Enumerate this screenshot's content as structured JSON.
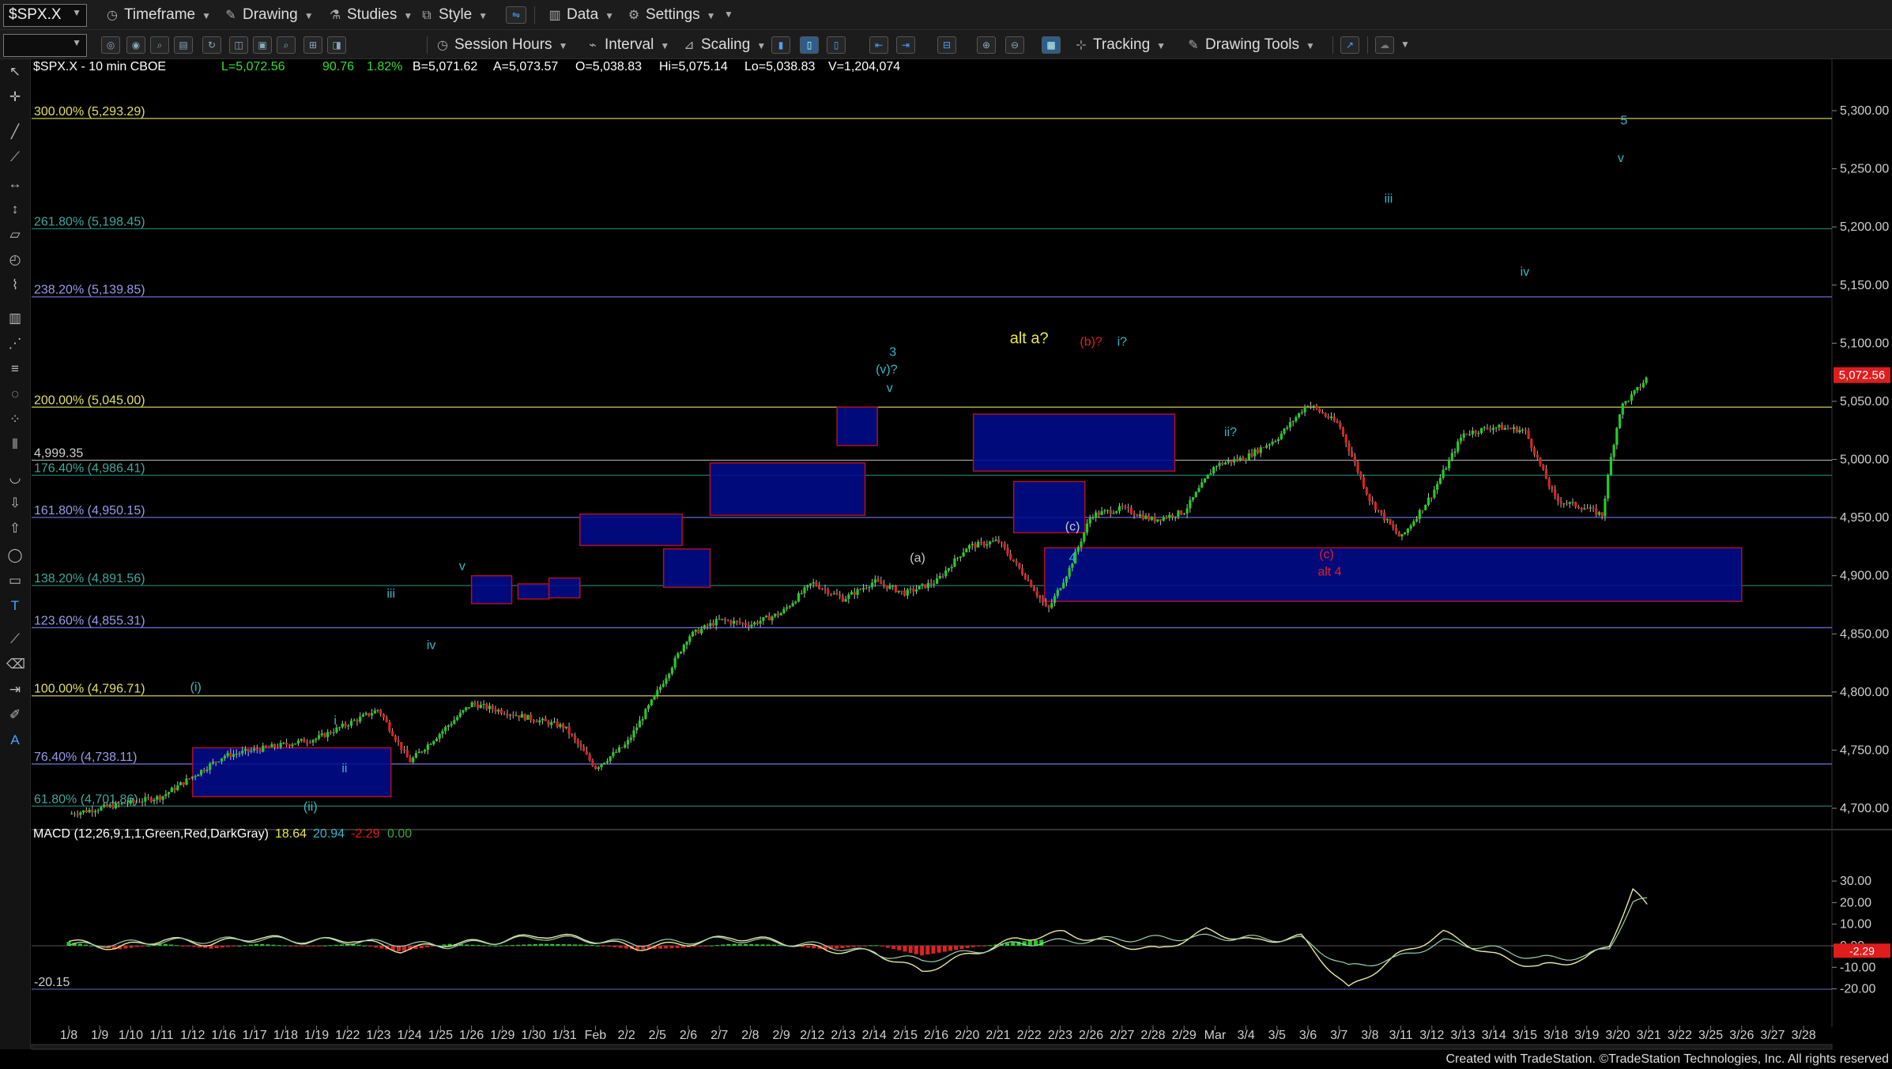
{
  "toolbar1": {
    "symbol": "$SPX.X",
    "items": [
      "Timeframe",
      "Drawing",
      "Studies",
      "Style",
      "Data",
      "Settings"
    ]
  },
  "toolbar2": {
    "items": [
      "Session Hours",
      "Interval",
      "Scaling",
      "Tracking",
      "Drawing Tools"
    ]
  },
  "header": {
    "symbol": "$SPX.X - 10 min  CBOE",
    "last": "L=5,072.56",
    "change": "90.76",
    "change_pct": "1.82%",
    "bid": "B=5,071.62",
    "ask": "A=5,073.57",
    "open": "O=5,038.83",
    "high": "Hi=5,075.14",
    "low": "Lo=5,038.83",
    "volume": "V=1,204,074"
  },
  "macd_header": {
    "name": "MACD (12,26,9,1,1,Green,Red,DarkGray)",
    "v1": "18.64",
    "v2": "20.94",
    "v3": "-2.29",
    "v4": "0.00"
  },
  "footer": "Created with TradeStation. ©TradeStation Technologies, Inc. All rights reserved",
  "colors": {
    "up": "#22cc22",
    "down": "#dd2222",
    "box_fill": "#000b8c",
    "box_border": "#b01020",
    "wave_cyan": "#37b7c7",
    "wave_red": "#e02020",
    "wave_yellow": "#e8e840",
    "price_tag": "#e01c1c"
  },
  "chart_data": [
    {
      "type": "candlestick",
      "title": "$SPX.X - 10 min",
      "ylim": [
        4680,
        5340
      ],
      "y_ticks": [
        "4,700.00",
        "4,750.00",
        "4,800.00",
        "4,850.00",
        "4,900.00",
        "4,950.00",
        "5,000.00",
        "5,050.00",
        "5,100.00",
        "5,150.00",
        "5,200.00",
        "5,250.00",
        "5,300.00"
      ],
      "x_ticks": [
        "1/8",
        "1/9",
        "1/10",
        "1/11",
        "1/12",
        "1/16",
        "1/17",
        "1/18",
        "1/19",
        "1/22",
        "1/23",
        "1/24",
        "1/25",
        "1/26",
        "1/29",
        "1/30",
        "1/31",
        "Feb",
        "2/2",
        "2/5",
        "2/6",
        "2/7",
        "2/8",
        "2/9",
        "2/12",
        "2/13",
        "2/14",
        "2/15",
        "2/16",
        "2/20",
        "2/21",
        "2/22",
        "2/23",
        "2/26",
        "2/27",
        "2/28",
        "2/29",
        "Mar",
        "3/4",
        "3/5",
        "3/6",
        "3/7",
        "3/8",
        "3/11",
        "3/12",
        "3/13",
        "3/14",
        "3/15",
        "3/18",
        "3/19",
        "3/20",
        "3/21",
        "3/22",
        "3/25",
        "3/26",
        "3/27",
        "3/28"
      ],
      "last_price_tag": "5,072.56",
      "price_path": [
        [
          0,
          4695
        ],
        [
          3,
          4710
        ],
        [
          5,
          4745
        ],
        [
          8,
          4760
        ],
        [
          10,
          4785
        ],
        [
          11,
          4740
        ],
        [
          13,
          4790
        ],
        [
          16,
          4770
        ],
        [
          17,
          4735
        ],
        [
          18,
          4755
        ],
        [
          19,
          4800
        ],
        [
          20,
          4848
        ],
        [
          21,
          4862
        ],
        [
          22,
          4858
        ],
        [
          23,
          4868
        ],
        [
          24,
          4894
        ],
        [
          25,
          4880
        ],
        [
          26,
          4895
        ],
        [
          27,
          4885
        ],
        [
          28,
          4895
        ],
        [
          29,
          4925
        ],
        [
          30,
          4930
        ],
        [
          31,
          4895
        ],
        [
          31.6,
          4870
        ],
        [
          32.3,
          4906
        ],
        [
          33,
          4952
        ],
        [
          34,
          4958
        ],
        [
          35,
          4948
        ],
        [
          36,
          4955
        ],
        [
          37,
          4995
        ],
        [
          38,
          5002
        ],
        [
          39,
          5018
        ],
        [
          40,
          5048
        ],
        [
          41,
          5030
        ],
        [
          42,
          4965
        ],
        [
          43,
          4932
        ],
        [
          44,
          4970
        ],
        [
          45,
          5022
        ],
        [
          46,
          5028
        ],
        [
          47,
          5025
        ],
        [
          48,
          4965
        ],
        [
          49,
          4958
        ],
        [
          49.5,
          4952
        ],
        [
          49.8,
          5005
        ],
        [
          50.1,
          5045
        ],
        [
          50.7,
          5062
        ],
        [
          51.0,
          5072.56
        ]
      ],
      "fib_levels": [
        {
          "label": "300.00% (5,293.29)",
          "price": 5293.29,
          "color": "#b8b84a"
        },
        {
          "label": "261.80% (5,198.45)",
          "price": 5198.45,
          "color": "#1e7a6e"
        },
        {
          "label": "238.20% (5,139.85)",
          "price": 5139.85,
          "color": "#6a6ac8"
        },
        {
          "label": "200.00% (5,045.00)",
          "price": 5045.0,
          "color": "#b8b84a"
        },
        {
          "label": "4,999.35",
          "price": 4999.35,
          "color": "#a0a0a0"
        },
        {
          "label": "176.40% (4,986.41)",
          "price": 4986.41,
          "color": "#1e7a6e"
        },
        {
          "label": "161.80% (4,950.15)",
          "price": 4950.15,
          "color": "#6a6ac8"
        },
        {
          "label": "138.20% (4,891.56)",
          "price": 4891.56,
          "color": "#1e7a6e"
        },
        {
          "label": "123.60% (4,855.31)",
          "price": 4855.31,
          "color": "#6a6ac8"
        },
        {
          "label": "100.00% (4,796.71)",
          "price": 4796.71,
          "color": "#b8b84a"
        },
        {
          "label": "76.40% (4,738.11)",
          "price": 4738.11,
          "color": "#6a6ac8"
        },
        {
          "label": "61.80% (4,701.86)",
          "price": 4701.86,
          "color": "#1e7a6e"
        }
      ],
      "boxes": [
        {
          "x0": 4.0,
          "x1": 10.4,
          "p_hi": 4752,
          "p_lo": 4710
        },
        {
          "x0": 13.0,
          "x1": 14.3,
          "p_hi": 4900,
          "p_lo": 4876
        },
        {
          "x0": 14.5,
          "x1": 15.5,
          "p_hi": 4893,
          "p_lo": 4880
        },
        {
          "x0": 15.5,
          "x1": 16.5,
          "p_hi": 4898,
          "p_lo": 4881
        },
        {
          "x0": 16.5,
          "x1": 19.8,
          "p_hi": 4953,
          "p_lo": 4926
        },
        {
          "x0": 19.2,
          "x1": 20.7,
          "p_hi": 4923,
          "p_lo": 4890
        },
        {
          "x0": 20.7,
          "x1": 25.7,
          "p_hi": 4997,
          "p_lo": 4952
        },
        {
          "x0": 24.8,
          "x1": 26.1,
          "p_hi": 5045,
          "p_lo": 5012
        },
        {
          "x0": 29.2,
          "x1": 35.7,
          "p_hi": 5039,
          "p_lo": 4990
        },
        {
          "x0": 30.5,
          "x1": 32.8,
          "p_hi": 4981,
          "p_lo": 4937
        },
        {
          "x0": 31.5,
          "x1": 54.0,
          "p_hi": 4924,
          "p_lo": 4878
        }
      ],
      "wave_labels": [
        {
          "text": "(i)",
          "x": 4.1,
          "p": 4801,
          "color": "cyan"
        },
        {
          "text": "(ii)",
          "x": 7.8,
          "p": 4698,
          "color": "cyan"
        },
        {
          "text": "i",
          "x": 8.6,
          "p": 4772,
          "color": "cyan"
        },
        {
          "text": "ii",
          "x": 8.9,
          "p": 4731,
          "color": "cyan"
        },
        {
          "text": "iii",
          "x": 10.4,
          "p": 4881,
          "color": "cyan"
        },
        {
          "text": "iv",
          "x": 11.7,
          "p": 4837,
          "color": "cyan"
        },
        {
          "text": "v",
          "x": 12.7,
          "p": 4905,
          "color": "cyan"
        },
        {
          "text": "3",
          "x": 26.6,
          "p": 5089,
          "color": "cyan"
        },
        {
          "text": "(v)?",
          "x": 26.4,
          "p": 5074,
          "color": "cyan"
        },
        {
          "text": "v",
          "x": 26.5,
          "p": 5058,
          "color": "cyan"
        },
        {
          "text": "(a)",
          "x": 27.4,
          "p": 4912,
          "color": "gray"
        },
        {
          "text": "alt a?",
          "x": 31.0,
          "p": 5100,
          "color": "yellow"
        },
        {
          "text": "(b)?",
          "x": 33.0,
          "p": 5098,
          "color": "red"
        },
        {
          "text": "i?",
          "x": 34.0,
          "p": 5098,
          "color": "cyan"
        },
        {
          "text": "(c)",
          "x": 32.4,
          "p": 4939,
          "color": "gray"
        },
        {
          "text": "4",
          "x": 32.4,
          "p": 4912,
          "color": "cyan"
        },
        {
          "text": "ii?",
          "x": 37.5,
          "p": 5020,
          "color": "cyan"
        },
        {
          "text": "(c)",
          "x": 40.6,
          "p": 4915,
          "color": "red"
        },
        {
          "text": "alt 4",
          "x": 40.7,
          "p": 4900,
          "color": "red"
        },
        {
          "text": "iii",
          "x": 42.6,
          "p": 5221,
          "color": "cyan"
        },
        {
          "text": "iv",
          "x": 47.0,
          "p": 5158,
          "color": "cyan"
        },
        {
          "text": "v",
          "x": 50.1,
          "p": 5256,
          "color": "cyan"
        },
        {
          "text": "5",
          "x": 50.2,
          "p": 5288,
          "color": "cyan"
        }
      ]
    },
    {
      "type": "line",
      "title": "MACD (12,26,9,1,1,Green,Red,DarkGray)",
      "ylim": [
        -24,
        32
      ],
      "y_ticks": [
        "30.00",
        "20.00",
        "10.00",
        "0.00",
        "-10.00",
        "-20.00"
      ],
      "reference_levels": [
        {
          "label": "-20.15",
          "value": -20.15
        }
      ],
      "last_value_tag": "-2.29",
      "macd_path": [
        [
          0,
          2
        ],
        [
          1,
          -1
        ],
        [
          2,
          3
        ],
        [
          3,
          1
        ],
        [
          4,
          4
        ],
        [
          5,
          2
        ],
        [
          6,
          3
        ],
        [
          7,
          -2
        ],
        [
          8,
          1
        ],
        [
          9,
          2
        ],
        [
          10,
          5
        ],
        [
          11,
          3
        ],
        [
          12,
          -1
        ],
        [
          13,
          1
        ],
        [
          14,
          4
        ],
        [
          15,
          2
        ],
        [
          16,
          -2
        ],
        [
          17,
          -3
        ],
        [
          18,
          -12
        ],
        [
          19,
          -4
        ],
        [
          20,
          3
        ],
        [
          21,
          6
        ],
        [
          22,
          1
        ],
        [
          23,
          -2
        ],
        [
          24,
          7
        ],
        [
          25,
          2
        ],
        [
          26,
          4
        ],
        [
          27,
          -20
        ],
        [
          28,
          -5
        ],
        [
          29,
          6
        ],
        [
          30,
          -4
        ],
        [
          31,
          -10
        ],
        [
          32,
          -6
        ],
        [
          32.5,
          0
        ],
        [
          33.0,
          26
        ],
        [
          33.3,
          18
        ]
      ],
      "signal_path": [
        [
          0,
          0
        ],
        [
          2,
          2
        ],
        [
          4,
          3
        ],
        [
          6,
          2
        ],
        [
          8,
          0
        ],
        [
          10,
          4
        ],
        [
          12,
          1
        ],
        [
          14,
          3
        ],
        [
          16,
          0
        ],
        [
          18,
          -7
        ],
        [
          20,
          1
        ],
        [
          22,
          3
        ],
        [
          24,
          4
        ],
        [
          26,
          3
        ],
        [
          27,
          -10
        ],
        [
          28,
          -6
        ],
        [
          29,
          2
        ],
        [
          30,
          -1
        ],
        [
          31,
          -6
        ],
        [
          32,
          -5
        ],
        [
          32.5,
          -1
        ],
        [
          33.0,
          20
        ],
        [
          33.3,
          21
        ]
      ]
    }
  ]
}
